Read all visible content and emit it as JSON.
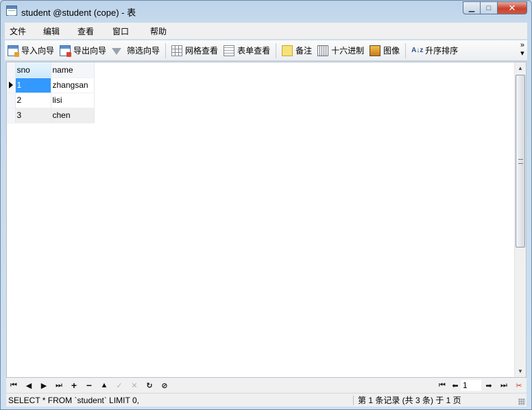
{
  "window": {
    "title": "student @student (cope) - 表",
    "minimize": "▁",
    "maximize": "□",
    "close": "✕"
  },
  "menu": [
    "文件",
    "编辑",
    "查看",
    "窗口",
    "帮助"
  ],
  "toolbar": {
    "import_wizard": "导入向导",
    "export_wizard": "导出向导",
    "filter_wizard": "筛选向导",
    "grid_view": "网格查看",
    "form_view": "表单查看",
    "memo": "备注",
    "hex": "十六进制",
    "image": "图像",
    "sort_asc": "升序排序",
    "more": "»"
  },
  "grid": {
    "columns": [
      "sno",
      "name"
    ],
    "rows": [
      {
        "sno": "1",
        "name": "zhangsan"
      },
      {
        "sno": "2",
        "name": "lisi"
      },
      {
        "sno": "3",
        "name": "chen"
      }
    ],
    "selected_row": 0
  },
  "navigation": {
    "first": "⏮",
    "prev": "◀",
    "next": "▶",
    "last": "⏭",
    "add": "+",
    "delete": "−",
    "up": "▲",
    "apply": "✓",
    "discard": "✕",
    "refresh": "↻",
    "stop": "⊘",
    "page_value": "1"
  },
  "status": {
    "sql": "SELECT * FROM `student` LIMIT 0,",
    "record_info": "第 1 条记录 (共 3 条) 于 1 页"
  }
}
